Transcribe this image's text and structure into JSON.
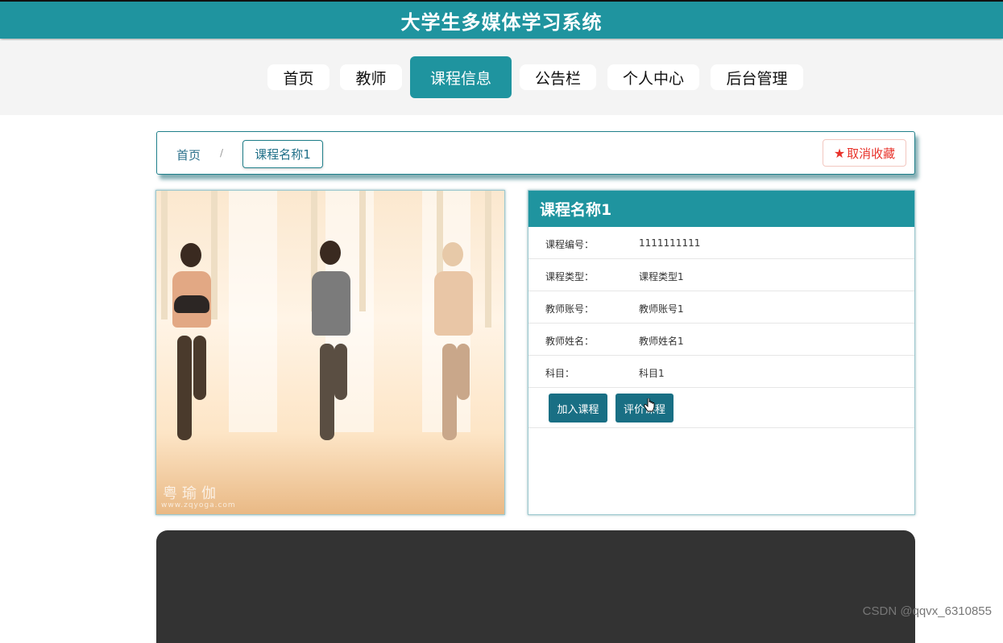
{
  "header": {
    "title": "大学生多媒体学习系统"
  },
  "nav": {
    "items": [
      {
        "label": "首页",
        "active": false
      },
      {
        "label": "教师",
        "active": false
      },
      {
        "label": "课程信息",
        "active": true
      },
      {
        "label": "公告栏",
        "active": false
      },
      {
        "label": "个人中心",
        "active": false
      },
      {
        "label": "后台管理",
        "active": false
      }
    ]
  },
  "breadcrumb": {
    "home": "首页",
    "separator": "/",
    "current": "课程名称1"
  },
  "favorite": {
    "label": "取消收藏",
    "icon": "star-icon"
  },
  "image": {
    "watermark": "粤瑜伽",
    "watermark_url": "www.zqyoga.com"
  },
  "course": {
    "title": "课程名称1",
    "fields": [
      {
        "label": "课程编号：",
        "value": "1111111111"
      },
      {
        "label": "课程类型：",
        "value": "课程类型1"
      },
      {
        "label": "教师账号：",
        "value": "教师账号1"
      },
      {
        "label": "教师姓名：",
        "value": "教师姓名1"
      },
      {
        "label": "科目：",
        "value": "科目1"
      }
    ],
    "actions": {
      "join": "加入课程",
      "review": "评价课程"
    }
  },
  "footer_watermark": "CSDN @qqvx_6310855",
  "colors": {
    "primary": "#1f949f",
    "button": "#196f84",
    "favorite": "#e8322a",
    "dark": "#333333"
  }
}
